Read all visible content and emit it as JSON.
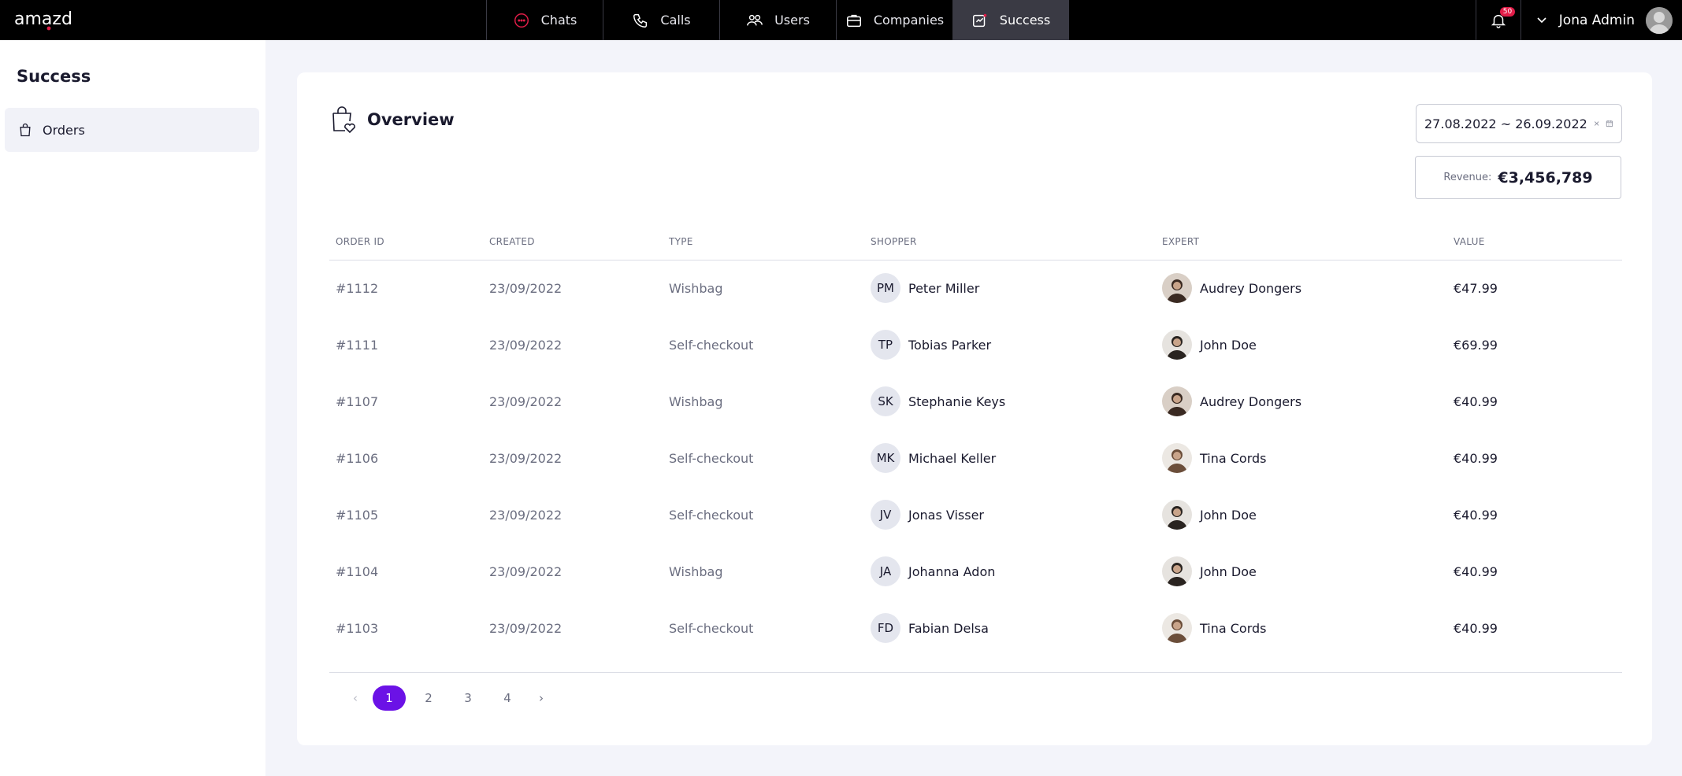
{
  "brand": {
    "logo_text": "amazd"
  },
  "nav": [
    {
      "label": "Chats",
      "icon": "chat-icon"
    },
    {
      "label": "Calls",
      "icon": "phone-icon"
    },
    {
      "label": "Users",
      "icon": "users-icon"
    },
    {
      "label": "Companies",
      "icon": "briefcase-icon"
    },
    {
      "label": "Success",
      "icon": "success-icon",
      "active": true
    }
  ],
  "notifications": {
    "count": "50"
  },
  "user": {
    "name": "Jona Admin"
  },
  "sidebar": {
    "title": "Success",
    "items": [
      {
        "label": "Orders",
        "icon": "bag-icon"
      }
    ]
  },
  "overview": {
    "title": "Overview",
    "date_range": "27.08.2022 ~ 26.09.2022",
    "revenue_label": "Revenue:",
    "revenue_value": "€3,456,789"
  },
  "table": {
    "headers": [
      "ORDER ID",
      "CREATED",
      "TYPE",
      "SHOPPER",
      "EXPERT",
      "VALUE"
    ],
    "rows": [
      {
        "id": "#1112",
        "created": "23/09/2022",
        "type": "Wishbag",
        "shopper": "Peter Miller",
        "shopper_initials": "PM",
        "expert": "Audrey Dongers",
        "value": "€47.99"
      },
      {
        "id": "#1111",
        "created": "23/09/2022",
        "type": "Self-checkout",
        "shopper": "Tobias Parker",
        "shopper_initials": "TP",
        "expert": "John Doe",
        "value": "€69.99"
      },
      {
        "id": "#1107",
        "created": "23/09/2022",
        "type": "Wishbag",
        "shopper": "Stephanie Keys",
        "shopper_initials": "SK",
        "expert": "Audrey Dongers",
        "value": "€40.99"
      },
      {
        "id": "#1106",
        "created": "23/09/2022",
        "type": "Self-checkout",
        "shopper": "Michael Keller",
        "shopper_initials": "MK",
        "expert": "Tina Cords",
        "value": "€40.99"
      },
      {
        "id": "#1105",
        "created": "23/09/2022",
        "type": "Self-checkout",
        "shopper": "Jonas Visser",
        "shopper_initials": "JV",
        "expert": "John Doe",
        "value": "€40.99"
      },
      {
        "id": "#1104",
        "created": "23/09/2022",
        "type": "Wishbag",
        "shopper": "Johanna Adon",
        "shopper_initials": "JA",
        "expert": "John Doe",
        "value": "€40.99"
      },
      {
        "id": "#1103",
        "created": "23/09/2022",
        "type": "Self-checkout",
        "shopper": "Fabian Delsa",
        "shopper_initials": "FD",
        "expert": "Tina Cords",
        "value": "€40.99"
      }
    ]
  },
  "pagination": {
    "pages": [
      "1",
      "2",
      "3",
      "4"
    ],
    "current": "1",
    "prev": "‹",
    "next": "›"
  },
  "colors": {
    "accent": "#6b12e6",
    "topbar": "#000000",
    "badge": "#e11d48",
    "page_bg": "#f3f4fa"
  }
}
